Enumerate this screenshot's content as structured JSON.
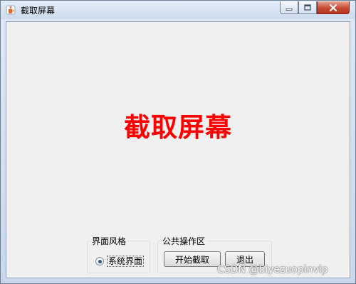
{
  "window": {
    "title": "截取屏幕",
    "icon": "java-cup-icon",
    "controls": [
      "minimize-icon",
      "maximize-icon",
      "close-icon"
    ]
  },
  "main": {
    "headline": "截取屏幕",
    "headline_color": "#ff0000"
  },
  "style_group": {
    "legend": "界面风格",
    "radio_label": "系统界面",
    "radio_selected": true
  },
  "ops_group": {
    "legend": "公共操作区",
    "start_label": "开始截取",
    "exit_label": "退出"
  },
  "watermark": "CSDN @biyezuopinvip"
}
